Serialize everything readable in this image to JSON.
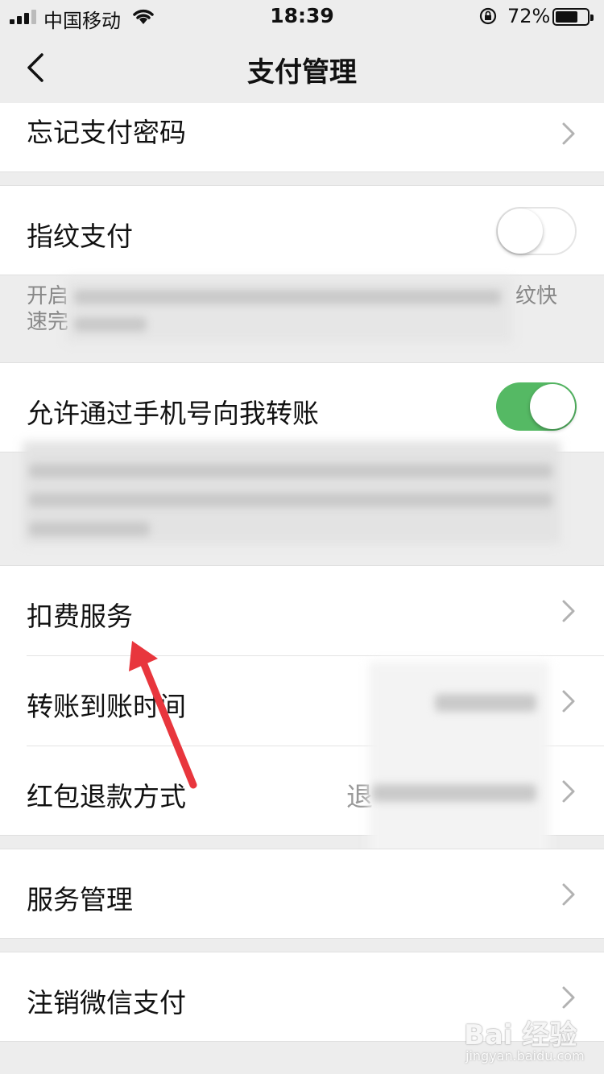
{
  "status_bar": {
    "carrier": "中国移动",
    "time": "18:39",
    "battery_percent": "72%",
    "battery_level": 0.72
  },
  "nav": {
    "title": "支付管理"
  },
  "rows": {
    "forgot_password": "忘记支付密码",
    "fingerprint_pay": "指纹支付",
    "fingerprint_pay_enabled": false,
    "fingerprint_desc_line1_start": "开启",
    "fingerprint_desc_line1_end": "纹快",
    "fingerprint_desc_line2_start": "速完",
    "phone_transfer": "允许通过手机号向我转账",
    "phone_transfer_enabled": true,
    "deduction_service": "扣费服务",
    "transfer_arrival_time": "转账到账时间",
    "red_packet_refund": "红包退款方式",
    "red_packet_refund_value_start": "退",
    "service_management": "服务管理",
    "cancel_wechat_pay": "注销微信支付"
  },
  "watermark": {
    "main": "Bai 经验",
    "sub": "jingyan.baidu.com"
  },
  "colors": {
    "toggle_on": "#55b964",
    "annotation_arrow": "#e8363d",
    "background": "#ededed"
  }
}
